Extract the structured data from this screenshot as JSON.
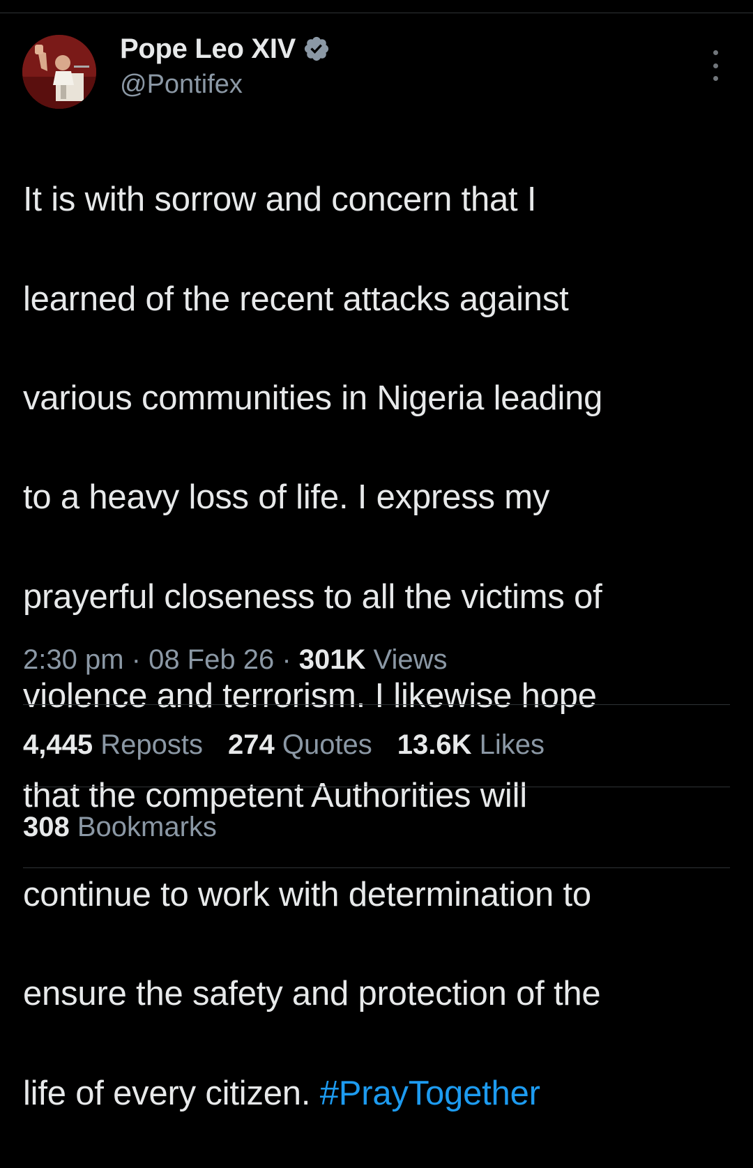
{
  "author": {
    "display_name": "Pope Leo XIV",
    "handle": "@Pontifex",
    "verified_icon": "verified-badge-icon",
    "avatar_icon": "avatar-photo"
  },
  "tweet": {
    "text_lines": [
      "It is with sorrow and concern that I",
      "learned of the recent attacks against",
      "various communities in Nigeria leading",
      "to a heavy loss of life.  I express my",
      "prayerful closeness to all the victims of",
      "violence and terrorism.  I likewise hope",
      "that the competent Authorities will",
      "continue to work with determination to",
      "ensure the safety and protection of the"
    ],
    "last_line_text": "life of every citizen. ",
    "hashtag": "#PrayTogether"
  },
  "meta": {
    "time": "2:30 pm",
    "separator": " · ",
    "date": "08 Feb 26",
    "views_count": "301K",
    "views_label": " Views"
  },
  "stats": {
    "reposts_count": "4,445",
    "reposts_label": " Reposts",
    "quotes_count": "274",
    "quotes_label": " Quotes",
    "likes_count": "13.6K",
    "likes_label": " Likes",
    "bookmarks_count": "308",
    "bookmarks_label": " Bookmarks"
  },
  "colors": {
    "background": "#000000",
    "text_primary": "#e7e9ea",
    "text_secondary": "#8b98a5",
    "accent": "#1d9bf0",
    "divider": "#2f3336"
  }
}
